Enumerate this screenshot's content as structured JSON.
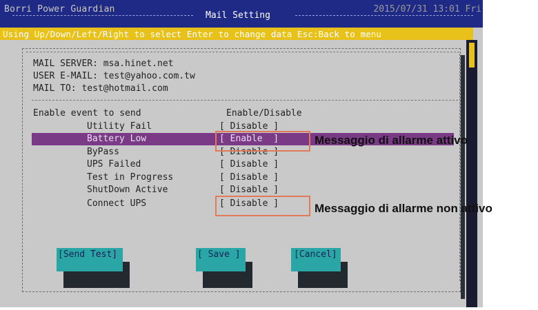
{
  "header": {
    "app_title": "Borri Power Guardian",
    "datetime": "2015/07/31 13:01 Fri",
    "screen_title": "Mail Setting",
    "hint": "Using Up/Down/Left/Right to select Enter to change data Esc:Back to menu"
  },
  "settings": {
    "mail_server": "MAIL SERVER: msa.hinet.net",
    "user_email": "USER E-MAIL: test@yahoo.com.tw",
    "mail_to": "MAIL TO: test@hotmail.com"
  },
  "events": {
    "header_label": "Enable event to send",
    "header_status": "Enable/Disable",
    "items": [
      {
        "name": "Utility Fail",
        "status": "[ Disable ]"
      },
      {
        "name": "Battery Low",
        "status": "[ Enable  ]"
      },
      {
        "name": "ByPass",
        "status": "[ Disable ]"
      },
      {
        "name": "UPS Failed",
        "status": "[ Disable ]"
      },
      {
        "name": "Test in Progress",
        "status": "[ Disable ]"
      },
      {
        "name": "ShutDown Active",
        "status": "[ Disable ]"
      },
      {
        "name": "Connect UPS",
        "status": "[ Disable ]"
      }
    ],
    "selected_index": 1
  },
  "annotations": {
    "active": "Messaggio di allarme attivo",
    "inactive": "Messaggio di allarme non attivo",
    "box_color": "#e07a5a"
  },
  "buttons": {
    "send_test": "[Send Test]",
    "save": "[ Save ]",
    "cancel": "[Cancel]"
  },
  "colors": {
    "title_bar": "#1f2a86",
    "hint_bar": "#e8c21a",
    "highlight": "#7a3a86",
    "button": "#2aa6a6",
    "background": "#c9c9c9"
  }
}
